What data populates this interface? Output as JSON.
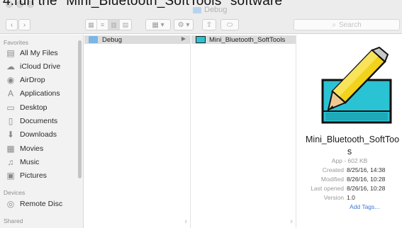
{
  "caption": "4.run the \"Mini_Bluetooth_SoftTools\" software",
  "window": {
    "title": "Debug"
  },
  "toolbar": {
    "back_glyph": "‹",
    "forward_glyph": "›",
    "view_glyphs": [
      "▦",
      "≡",
      "▥",
      "▤"
    ],
    "arrange_glyph": "▦ ▾",
    "action_glyph": "⚙ ▾",
    "share_glyph": "⇧",
    "tag_glyph": "⬭",
    "search_placeholder": "Search"
  },
  "sidebar": {
    "favorites_label": "Favorites",
    "favorites": [
      {
        "label": "All My Files",
        "icon": "all-files-icon",
        "glyph": "▤"
      },
      {
        "label": "iCloud Drive",
        "icon": "cloud-icon",
        "glyph": "☁"
      },
      {
        "label": "AirDrop",
        "icon": "airdrop-icon",
        "glyph": "◉"
      },
      {
        "label": "Applications",
        "icon": "applications-icon",
        "glyph": "A"
      },
      {
        "label": "Desktop",
        "icon": "desktop-icon",
        "glyph": "▭"
      },
      {
        "label": "Documents",
        "icon": "documents-icon",
        "glyph": "▯"
      },
      {
        "label": "Downloads",
        "icon": "downloads-icon",
        "glyph": "⬇"
      },
      {
        "label": "Movies",
        "icon": "movies-icon",
        "glyph": "▦"
      },
      {
        "label": "Music",
        "icon": "music-icon",
        "glyph": "♫"
      },
      {
        "label": "Pictures",
        "icon": "pictures-icon",
        "glyph": "▣"
      }
    ],
    "devices_label": "Devices",
    "devices": [
      {
        "label": "Remote Disc",
        "icon": "disc-icon",
        "glyph": "◎"
      }
    ],
    "shared_label": "Shared"
  },
  "columns": {
    "col1": [
      {
        "label": "Debug",
        "arrow": "▶"
      }
    ],
    "col2": [
      {
        "label": "Mini_Bluetooth_SoftTools"
      }
    ],
    "grip": "॥"
  },
  "preview": {
    "name_line1": "Mini_Bluetooth_SoftToo",
    "name_line2": "s",
    "kind": "App - 602 KB",
    "meta": [
      {
        "label": "Created",
        "value": "8/25/16, 14:38"
      },
      {
        "label": "Modified",
        "value": "8/26/16, 10:28"
      },
      {
        "label": "Last opened",
        "value": "8/26/16, 10:28"
      },
      {
        "label": "Version",
        "value": "1.0"
      }
    ],
    "add_tags": "Add Tags..."
  },
  "colors": {
    "folder": "#7ab6e6",
    "icon_cyan": "#2ac3d4",
    "pencil_yellow": "#f2d21b",
    "link_blue": "#3a78d8"
  }
}
